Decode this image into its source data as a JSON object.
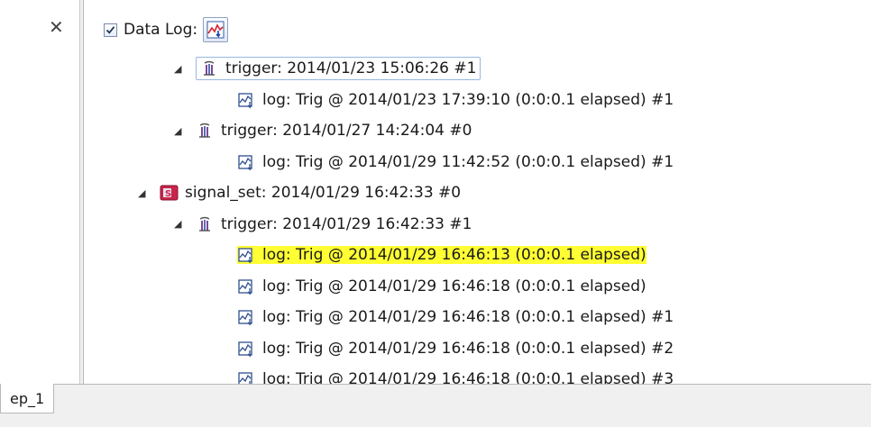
{
  "header": {
    "checked": true,
    "label": "Data Log:",
    "icon": "data-log-icon"
  },
  "tree": [
    {
      "indent": 0,
      "expanded": true,
      "icon": "trigger-icon",
      "text": "trigger: 2014/01/23 15:06:26  #1",
      "selected": true
    },
    {
      "indent": 1,
      "icon": "log-icon",
      "text": "log: Trig @ 2014/01/23 17:39:10 (0:0:0.1 elapsed) #1"
    },
    {
      "indent": 0,
      "expanded": true,
      "icon": "trigger-icon",
      "text": "trigger: 2014/01/27 14:24:04  #0"
    },
    {
      "indent": 1,
      "icon": "log-icon",
      "text": "log: Trig @ 2014/01/29 11:42:52 (0:0:0.1 elapsed) #1"
    },
    {
      "indent": -1,
      "expanded": true,
      "icon": "signal-set-icon",
      "text": "signal_set: 2014/01/29 16:42:33  #0"
    },
    {
      "indent": 0,
      "expanded": true,
      "icon": "trigger-icon",
      "text": "trigger: 2014/01/29 16:42:33  #1"
    },
    {
      "indent": 1,
      "icon": "log-icon",
      "text": "log: Trig @ 2014/01/29 16:46:13 (0:0:0.1 elapsed)",
      "highlighted": true
    },
    {
      "indent": 1,
      "icon": "log-icon",
      "text": "log: Trig @ 2014/01/29 16:46:18 (0:0:0.1 elapsed)"
    },
    {
      "indent": 1,
      "icon": "log-icon",
      "text": "log: Trig @ 2014/01/29 16:46:18 (0:0:0.1 elapsed) #1"
    },
    {
      "indent": 1,
      "icon": "log-icon",
      "text": "log: Trig @ 2014/01/29 16:46:18 (0:0:0.1 elapsed) #2"
    },
    {
      "indent": 1,
      "icon": "log-icon",
      "text": "log: Trig @ 2014/01/29 16:46:18 (0:0:0.1 elapsed) #3"
    }
  ],
  "bottom_tab": {
    "label": "ep_1"
  },
  "colors": {
    "highlight": "#ffff33",
    "selection_border": "#99b7e0"
  }
}
